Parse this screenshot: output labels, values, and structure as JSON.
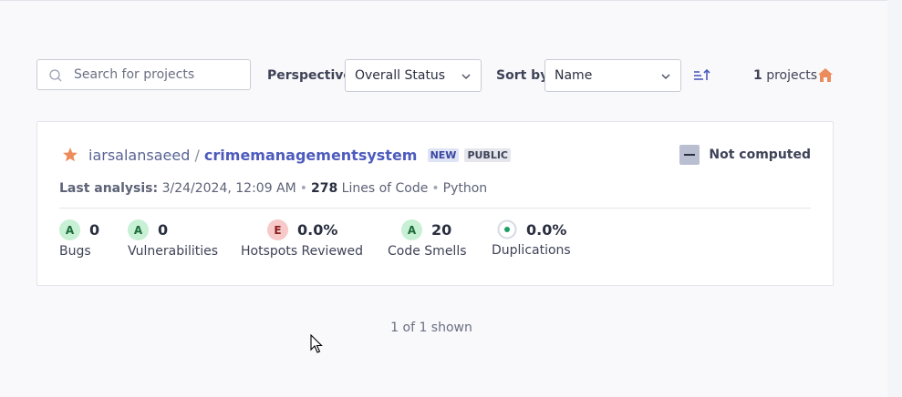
{
  "search": {
    "placeholder": "Search for projects",
    "value": ""
  },
  "perspective": {
    "label": "Perspective",
    "selected": "Overall Status"
  },
  "sort": {
    "label": "Sort by",
    "selected": "Name"
  },
  "count": {
    "number": "1",
    "suffix": "projects"
  },
  "project": {
    "org": "iarsalansaeed",
    "separator": "/",
    "name": "crimemanagementsystem",
    "tags": [
      "NEW",
      "PUBLIC"
    ],
    "quality_gate": "Not computed",
    "last_analysis_label": "Last analysis:",
    "last_analysis_value": "3/24/2024, 12:09 AM",
    "lines": "278",
    "lines_label": "Lines of Code",
    "language": "Python",
    "metrics": [
      {
        "rating": "A",
        "value": "0",
        "label": "Bugs"
      },
      {
        "rating": "A",
        "value": "0",
        "label": "Vulnerabilities"
      },
      {
        "rating": "E",
        "value": "0.0%",
        "label": "Hotspots Reviewed"
      },
      {
        "rating": "A",
        "value": "20",
        "label": "Code Smells"
      },
      {
        "rating": "",
        "value": "0.0%",
        "label": "Duplications"
      }
    ]
  },
  "footer": {
    "shown": "1 of 1 shown"
  },
  "colors": {
    "accent": "#4d5bbd",
    "star": "#ec8c5c",
    "rating_a": "#c7f0d5",
    "rating_e": "#f7c9c9",
    "duplication_dot": "#1aa063"
  },
  "icons": [
    "search-icon",
    "chevron-down-icon",
    "sort-ascending-icon",
    "home-icon",
    "star-icon",
    "quality-gate-icon",
    "duplication-icon",
    "cursor-icon"
  ]
}
